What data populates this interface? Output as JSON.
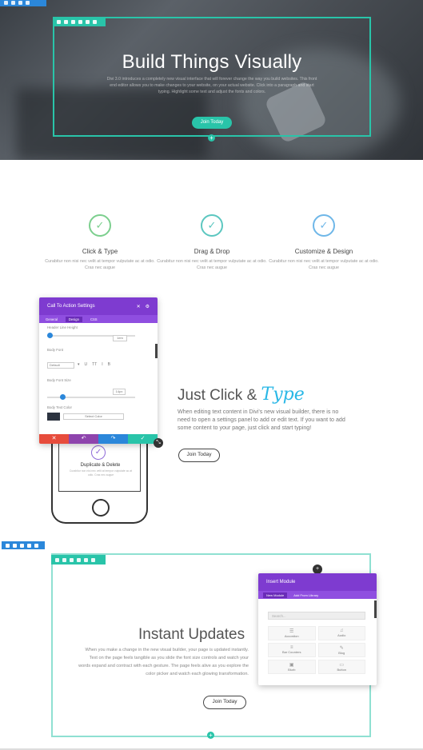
{
  "hero": {
    "title": "Build Things Visually",
    "text": "Divi 3.0 introduces a completely new visual interface that will forever change the way you build websites. This front end editor allows you to make changes to your website, on your actual website. Click into a paragraph and start typing. Highlight some text and adjust the fonts and colors.",
    "button": "Join Today"
  },
  "features": [
    {
      "title": "Click & Type",
      "text": "Curabitur non nisi nec velit at tempor vulputate ac at odio. Cras nec augue",
      "icon": "check-icon",
      "color": "#7ccf8e"
    },
    {
      "title": "Drag & Drop",
      "text": "Curabitur non nisi nec velit at tempor vulputate ac at odio. Cras nec augue",
      "icon": "check-icon",
      "color": "#5cc7c0"
    },
    {
      "title": "Customize & Design",
      "text": "Curabitur non nisi nec velit at tempor vulputate ac at odio. Cras nec augue",
      "icon": "check-icon",
      "color": "#6fb7e8"
    }
  ],
  "settings_panel": {
    "title": "Call To Action Settings",
    "tabs": [
      "General",
      "Design",
      "CSS"
    ],
    "header_line_height_label": "Header Line Height",
    "header_line_height_value": "1em",
    "body_font_label": "Body Font",
    "body_font_value": "Default",
    "body_font_size_label": "Body Font Size",
    "body_font_size_value": "14px",
    "body_text_color_label": "Body Text Color",
    "body_text_color_value": "Select Color"
  },
  "duplicate_card": {
    "title": "Duplicate & Delete",
    "text": "Curabitur non nisi nec velit at tempor vulputate ac at odio. Cras nec augue"
  },
  "click_type": {
    "title": "Just Click &",
    "script": "Type",
    "text": "When editing text content in Divi's new visual builder, there is no need to open a settings panel to add or edit text. If you want to add some content to your page, just click and start typing!",
    "button": "Join Today"
  },
  "instant_updates": {
    "title": "Instant Updates",
    "text": "When you make a change in the new visual builder, your page is updated instantly. Text on the page feels tangible as you slide the font size controls and watch your words expand and contract with each gesture. The page feels alive as you explore the color picker and watch each glowing transformation.",
    "button": "Join Today"
  },
  "insert_module": {
    "title": "Insert Module",
    "tabs": [
      "New Module",
      "Add From Library"
    ],
    "search_placeholder": "Search...",
    "modules": [
      "Accordion",
      "Audio",
      "Bar Counters",
      "Blog",
      "Blurb",
      "Button"
    ]
  },
  "colors": {
    "accent": "#29c4a9",
    "purple": "#7e3bd0",
    "blue": "#2b87da",
    "footer_buttons": [
      "#e74c3c",
      "#8e44ad",
      "#2b87da",
      "#29c4a9"
    ]
  }
}
